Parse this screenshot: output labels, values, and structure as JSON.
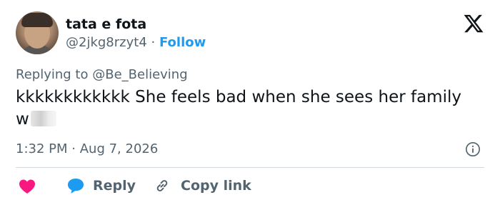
{
  "author": {
    "display_name": "tata e fota",
    "handle": "@2jkg8rzyt4",
    "separator": "·",
    "follow_label": "Follow"
  },
  "reply_context": {
    "prefix": "Replying to",
    "mention": "@Be_Believing"
  },
  "tweet": {
    "text": "kkkkkkkkkkkk She feels bad when she sees her family w"
  },
  "meta": {
    "time": "1:32 PM",
    "separator": "·",
    "date": "Aug 7, 2026"
  },
  "actions": {
    "reply_label": "Reply",
    "copy_link_label": "Copy link"
  },
  "icons": {
    "logo": "x-logo-icon",
    "info": "info-icon",
    "like": "heart-icon",
    "reply": "chat-bubble-icon",
    "link": "link-icon"
  },
  "colors": {
    "text": "#0f1419",
    "secondary": "#536471",
    "accent": "#1d9bf0",
    "like": "#f91880",
    "divider": "#cfd9de"
  }
}
